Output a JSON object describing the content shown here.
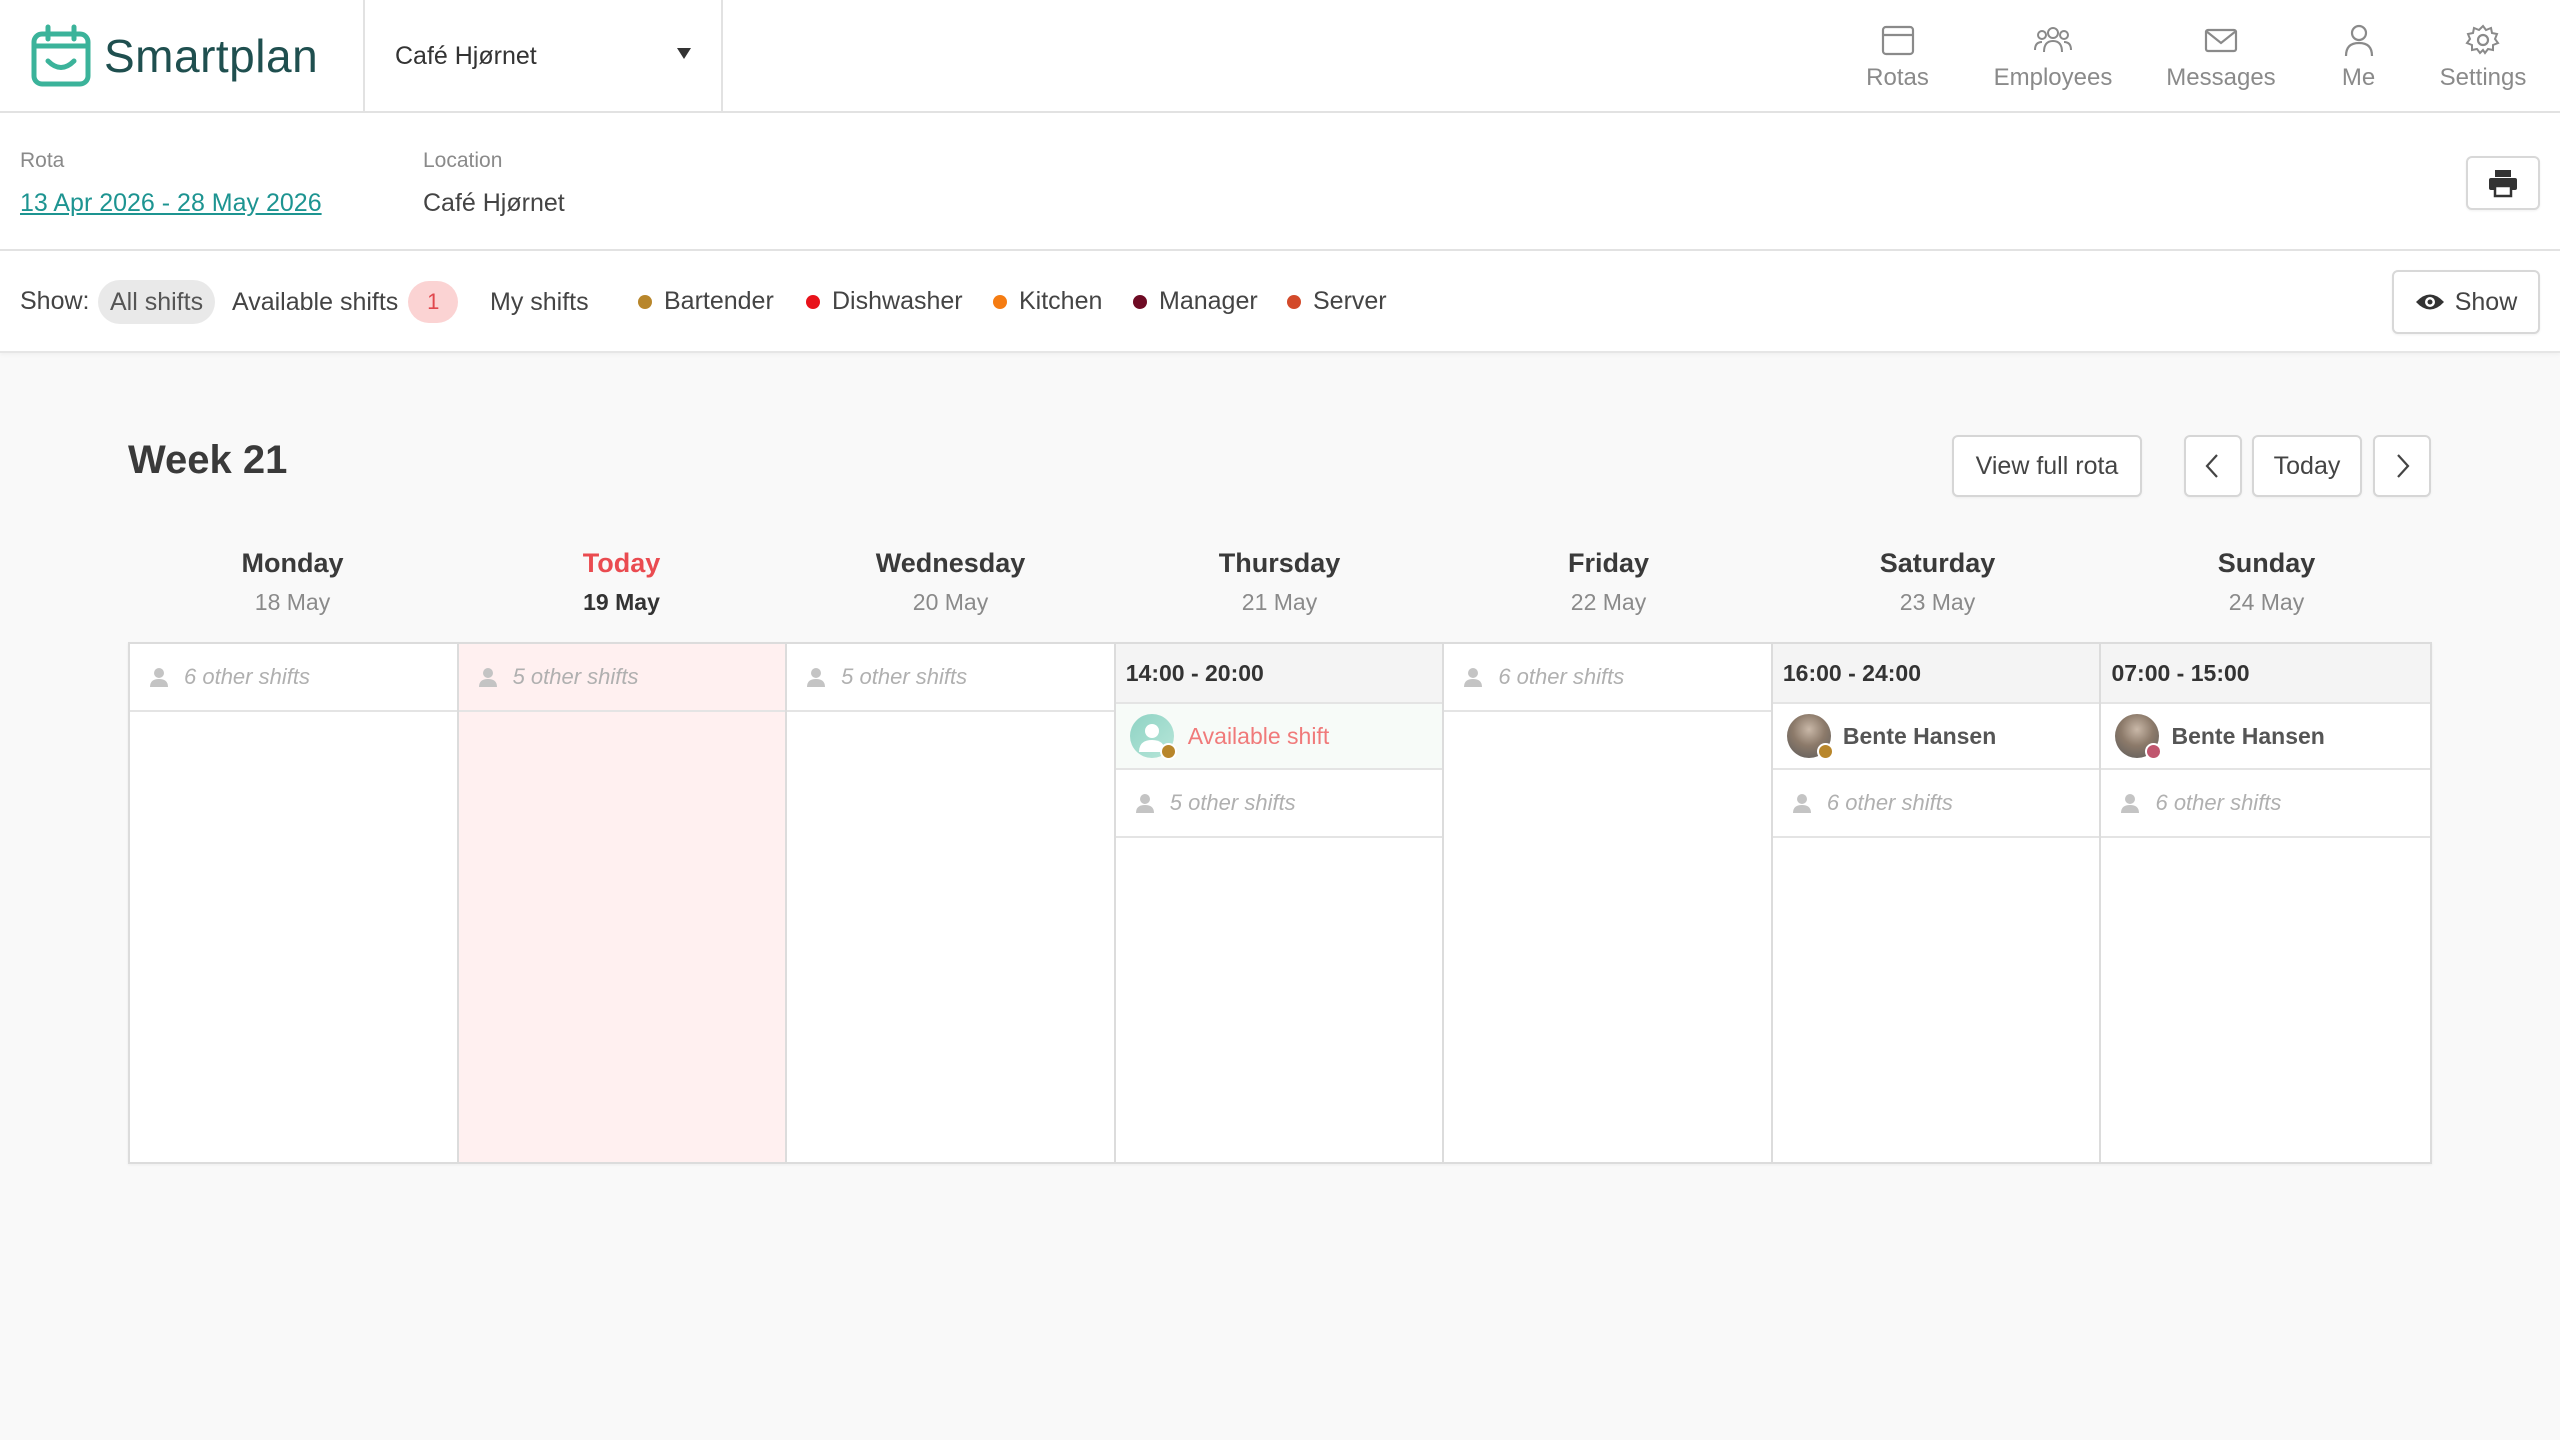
{
  "app": {
    "name": "Smartplan"
  },
  "location_select": {
    "value": "Café Hjørnet"
  },
  "nav": [
    {
      "label": "Rotas",
      "icon": "calendar-icon"
    },
    {
      "label": "Employees",
      "icon": "people-icon"
    },
    {
      "label": "Messages",
      "icon": "envelope-icon"
    },
    {
      "label": "Me",
      "icon": "user-icon"
    },
    {
      "label": "Settings",
      "icon": "gear-icon"
    }
  ],
  "rota_info": {
    "rota_label": "Rota",
    "rota_value": "13 Apr 2026 - 28 May 2026",
    "location_label": "Location",
    "location_value": "Café Hjørnet"
  },
  "filters": {
    "show_label": "Show:",
    "all_shifts": "All shifts",
    "available_shifts": "Available shifts",
    "available_count": "1",
    "my_shifts": "My shifts",
    "show_button": "Show",
    "roles": [
      {
        "name": "Bartender",
        "color": "#b8862b"
      },
      {
        "name": "Dishwasher",
        "color": "#e8131b"
      },
      {
        "name": "Kitchen",
        "color": "#f57c12"
      },
      {
        "name": "Manager",
        "color": "#6e0b24"
      },
      {
        "name": "Server",
        "color": "#d34a2a"
      }
    ]
  },
  "week": {
    "title": "Week 21",
    "view_full_rota": "View full rota",
    "today_button": "Today",
    "days": [
      {
        "name": "Monday",
        "date": "18 May",
        "other_shifts": "6 other shifts"
      },
      {
        "name": "Today",
        "date": "19 May",
        "other_shifts": "5 other shifts"
      },
      {
        "name": "Wednesday",
        "date": "20 May",
        "other_shifts": "5 other shifts"
      },
      {
        "name": "Thursday",
        "date": "21 May",
        "shift_time": "14:00 - 20:00",
        "shift_name": "Available shift",
        "other_shifts": "5 other shifts"
      },
      {
        "name": "Friday",
        "date": "22 May",
        "other_shifts": "6 other shifts"
      },
      {
        "name": "Saturday",
        "date": "23 May",
        "shift_time": "16:00 - 24:00",
        "shift_name": "Bente Hansen",
        "other_shifts": "6 other shifts"
      },
      {
        "name": "Sunday",
        "date": "24 May",
        "shift_time": "07:00 - 15:00",
        "shift_name": "Bente Hansen",
        "other_shifts": "6 other shifts"
      }
    ]
  }
}
